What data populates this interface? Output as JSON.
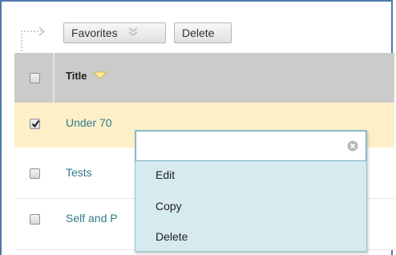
{
  "toolbar": {
    "favorites_label": "Favorites",
    "delete_label": "Delete"
  },
  "table": {
    "header": {
      "title_label": "Title"
    },
    "rows": [
      {
        "title": "Under 70",
        "checked": true
      },
      {
        "title": "Tests",
        "checked": false
      },
      {
        "title": "Self and P",
        "checked": false
      }
    ]
  },
  "context_menu": {
    "filter_value": "",
    "items": [
      {
        "label": "Edit"
      },
      {
        "label": "Copy"
      },
      {
        "label": "Delete"
      }
    ]
  },
  "icons": {
    "favorites_menu": "double-chevron-down-icon",
    "sort": "triangle-down-icon",
    "clear": "clear-circle-icon",
    "toolbar_indent": "dotted-corner-arrow-icon",
    "checkbox_checked": "checkmark-icon"
  },
  "colors": {
    "frame_border": "#4f79a8",
    "header_bg": "#cbcbcb",
    "selected_row_bg": "#fdf0c8",
    "link": "#2f7a8e",
    "menu_bg": "#d6eaf0",
    "menu_border": "#74a9c4"
  }
}
